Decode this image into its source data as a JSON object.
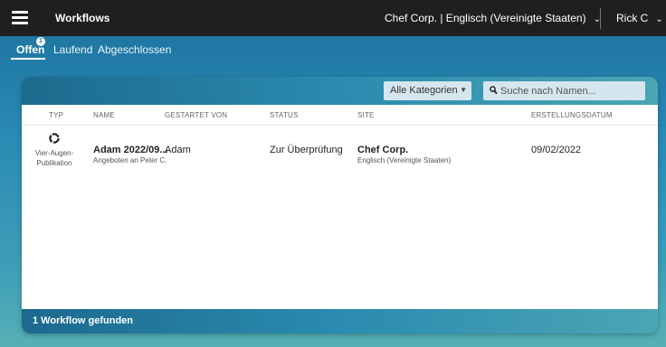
{
  "header": {
    "title": "Workflows",
    "tenant": "Chef Corp. | Englisch (Vereinigte Staaten)",
    "user": "Rick C"
  },
  "tabs": [
    {
      "label": "Offen",
      "badge": "1",
      "active": true
    },
    {
      "label": "Laufend",
      "active": false
    },
    {
      "label": "Abgeschlossen",
      "active": false
    }
  ],
  "filters": {
    "category": "Alle Kategorien",
    "search_placeholder": "Suche nach Namen..."
  },
  "table": {
    "columns": [
      "TYP",
      "NAME",
      "GESTARTET VON",
      "STATUS",
      "SITE",
      "ERSTELLUNGSDATUM"
    ],
    "rows": [
      {
        "type_icon": "workflow-cycle-icon",
        "type_label": "Vier-Augen-Publikation",
        "name": "Adam 2022/09...",
        "name_sub": "Angeboten an Peter C.",
        "started_by": "Adam",
        "status": "Zur Überprüfung",
        "site": "Chef Corp.",
        "site_sub": "Englisch (Vereinigte Staaten)",
        "created": "09/02/2022"
      }
    ]
  },
  "footer": {
    "count_text": "1 Workflow gefunden"
  },
  "colors": {
    "topbar": "#1f1f1f",
    "accent": "#1b6f9c",
    "field": "#d6e6ee"
  }
}
